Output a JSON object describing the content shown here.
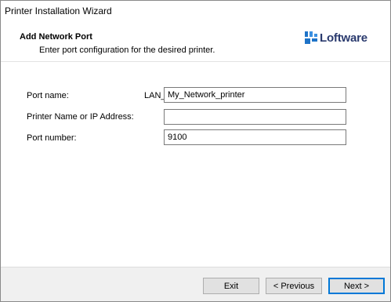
{
  "window": {
    "title": "Printer Installation Wizard"
  },
  "header": {
    "title": "Add Network Port",
    "subtitle": "Enter port configuration for the desired printer.",
    "logo_text": "Loftware",
    "logo_color": "#2a3a6e",
    "logo_mark_color": "#1e73c8"
  },
  "form": {
    "port_name": {
      "label": "Port name:",
      "prefix": "LAN_",
      "value": "My_Network_printer"
    },
    "printer_address": {
      "label": "Printer Name or IP Address:",
      "value": ""
    },
    "port_number": {
      "label": "Port number:",
      "value": "9100"
    }
  },
  "footer": {
    "exit_label": "Exit",
    "previous_label": "< Previous",
    "next_label": "Next >"
  }
}
